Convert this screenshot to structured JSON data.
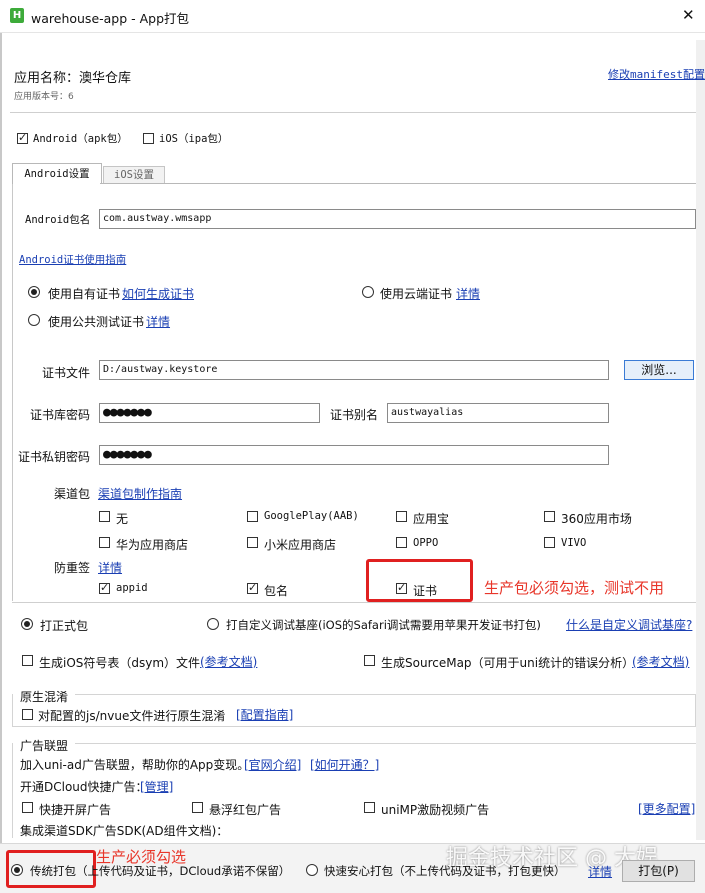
{
  "window": {
    "title": "warehouse-app - App打包",
    "close_glyph": "✕"
  },
  "app": {
    "name_label": "应用名称：澳华仓库",
    "version_label": "应用版本号：6",
    "manifest_link": "修改manifest配置"
  },
  "platforms": {
    "android": "Android（apk包）",
    "ios": "iOS（ipa包）"
  },
  "tabs": {
    "android": "Android设置",
    "ios": "iOS设置"
  },
  "android": {
    "package_label": "Android包名",
    "package_value": "com.austway.wmsapp",
    "cert_guide_link": "Android证书使用指南",
    "cert_own": "使用自有证书",
    "cert_own_link": "如何生成证书",
    "cert_cloud": "使用云端证书",
    "cert_cloud_link": "详情",
    "cert_public": "使用公共测试证书",
    "cert_public_link": "详情",
    "cert_file_label": "证书文件",
    "cert_file_value": "D:/austway.keystore",
    "browse_button": "浏览...",
    "store_pwd_label": "证书库密码",
    "store_pwd_value": "●●●●●●●",
    "alias_label": "证书别名",
    "alias_value": "austwayalias",
    "key_pwd_label": "证书私钥密码",
    "key_pwd_value": "●●●●●●●",
    "channel_label": "渠道包",
    "channel_link": "渠道包制作指南",
    "channels": [
      "无",
      "GooglePlay(AAB)",
      "应用宝",
      "360应用市场",
      "华为应用商店",
      "小米应用商店",
      "OPPO",
      "VIVO"
    ],
    "anti_label": "防重签",
    "anti_link": "详情",
    "anti_items": [
      "appid",
      "包名",
      "证书"
    ],
    "annotation": "生产包必须勾选，测试不用"
  },
  "build_type": {
    "release": "打正式包",
    "debug": "打自定义调试基座(iOS的Safari调试需要用苹果开发证书打包)",
    "debug_link": "什么是自定义调试基座?",
    "dsym": "生成iOS符号表（dsym）文件",
    "dsym_link": "(参考文档)",
    "sourcemap": "生成SourceMap（可用于uni统计的错误分析）",
    "sourcemap_link": "(参考文档)"
  },
  "obfuscation": {
    "title": "原生混淆",
    "option": "对配置的js/nvue文件进行原生混淆",
    "link": "[配置指南]"
  },
  "ads": {
    "title": "广告联盟",
    "intro": "加入uni-ad广告联盟，帮助你的App变现。",
    "intro_link1": "[官网介绍]",
    "intro_link2": "[如何开通？]",
    "dcloud_label": "开通DCloud快捷广告：",
    "manage_link": "[管理]",
    "splash": "快捷开屏广告",
    "float": "悬浮红包广告",
    "video": "uniMP激励视频广告",
    "more_link": "[更多配置]",
    "sdk_label": "集成渠道SDK广告SDK(AD组件文档)："
  },
  "footer": {
    "traditional": "传统打包（上传代码及证书，DCloud承诺不保留）",
    "fast": "快速安心打包（不上传代码及证书，打包更快）",
    "detail_link": "详情",
    "pack_button": "打包(P)",
    "annotation": "生产必须勾选",
    "watermark": "掘金技术社区 @ 大娱"
  },
  "colors": {
    "annotation_red": "#e8362a",
    "highlight_border": "#e02020",
    "link": "#1a3fb3",
    "app_icon": "#3dab3a"
  }
}
